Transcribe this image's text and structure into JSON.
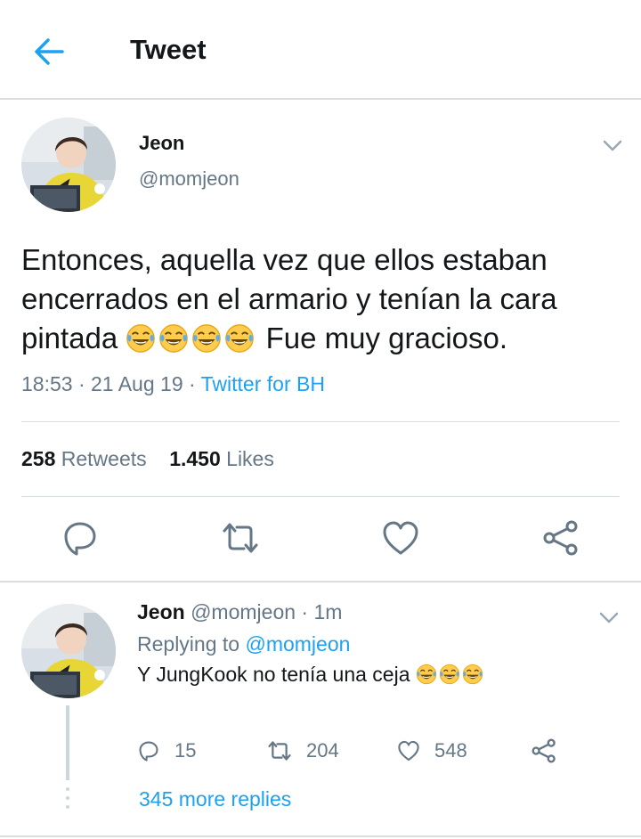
{
  "header": {
    "title": "Tweet",
    "back_icon": "arrow-left-icon"
  },
  "colors": {
    "accent": "#1da1f2",
    "secondary_text": "#657786",
    "primary_text": "#14171a",
    "divider": "#d8dde1"
  },
  "tweet": {
    "author_name": "Jeon",
    "handle": "@momjeon",
    "text_before_emoji": "Entonces, aquella vez que ellos estaban encerrados en el armario y tenían la cara pintada",
    "emoji": "face-with-tears-of-joy-icon",
    "emoji_count": 4,
    "text_after_emoji": "Fue muy gracioso.",
    "time": "18:53",
    "date": "21 Aug 19",
    "source": "Twitter for BH",
    "retweets_count": "258",
    "retweets_label": "Retweets",
    "likes_count": "1.450",
    "likes_label": "Likes"
  },
  "actions": [
    "reply-icon",
    "retweet-icon",
    "like-icon",
    "share-icon"
  ],
  "reply": {
    "author_name": "Jeon",
    "handle": "@momjeon",
    "time": "1m",
    "replying_to_label": "Replying to",
    "replying_to_handle": "@momjeon",
    "text": "Y JungKook no tenía una ceja",
    "emoji_count": 3,
    "reply_count": "15",
    "retweet_count": "204",
    "like_count": "548",
    "more_replies": "345 more replies"
  }
}
